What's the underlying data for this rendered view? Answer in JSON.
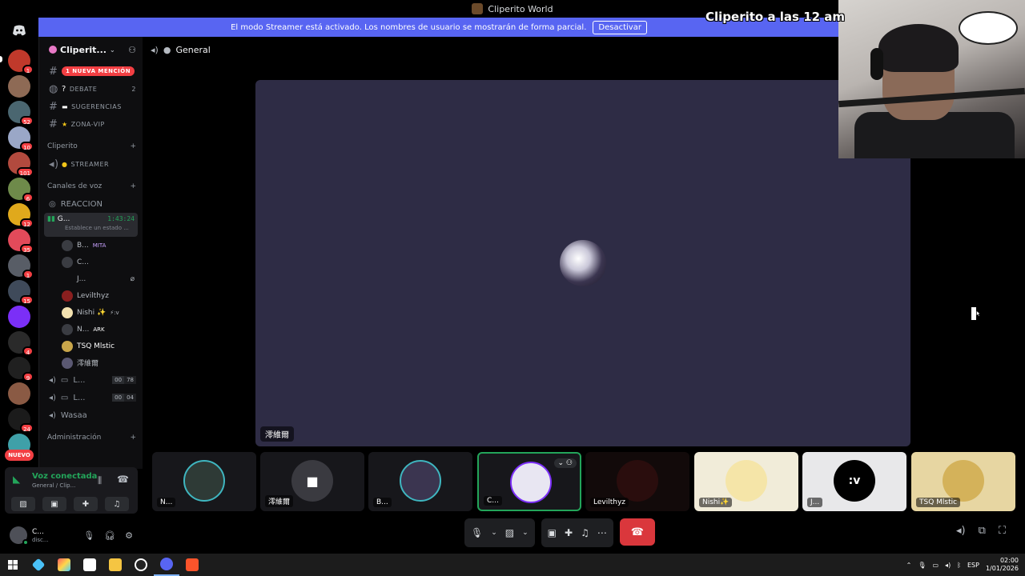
{
  "window": {
    "title": "Cliperito World"
  },
  "banner": {
    "text": "El modo Streamer está activado. Los nombres de usuario se mostrarán de forma parcial.",
    "button": "Desactivar"
  },
  "rail": {
    "badges": [
      "1",
      "52",
      "10",
      "101",
      "6",
      "12",
      "35",
      "1",
      "15",
      "4",
      "9",
      "24"
    ],
    "nuevo": "NUEVO"
  },
  "server": {
    "name": "Cliperit..."
  },
  "channels": {
    "mention_label": "1 NUEVA MENCIÓN",
    "debate": {
      "name": "DEBATE",
      "count": "2"
    },
    "sugerencias": "SUGERENCIAS",
    "zona_vip": "ZONA-VIP",
    "category_cliperito": "Cliperito",
    "streamer": "STREAMER",
    "category_voz": "Canales de voz",
    "reaccion": "REACCION",
    "active_voice": {
      "name": "G...",
      "timer": "1:43:24",
      "status": "Establece un estado ..."
    },
    "voice_users": [
      "B...",
      "MITA",
      "C...",
      "J...",
      "Levilthyz",
      "Nishi ✨",
      "⚡:v",
      "N...",
      "ARK",
      "TSQ Mlstic",
      "澪維爾"
    ],
    "vchannels": [
      {
        "name": "L...",
        "a": "00",
        "b": "78"
      },
      {
        "name": "L...",
        "a": "00",
        "b": "04"
      }
    ],
    "wasaa": "Wasaa",
    "category_admin": "Administración"
  },
  "voice_panel": {
    "status": "Voz conectada",
    "location": "General / Clip..."
  },
  "user": {
    "name": "C...",
    "status": "disc..."
  },
  "topbar": {
    "channel": "General"
  },
  "stage": {
    "label": "澪維爾"
  },
  "tiles": [
    {
      "name": "N..."
    },
    {
      "name": "澪維爾"
    },
    {
      "name": "B..."
    },
    {
      "name": "C..."
    },
    {
      "name": "Levilthyz"
    },
    {
      "name": "Nishi✨"
    },
    {
      "name": "J...",
      "avatar_text": ":v"
    },
    {
      "name": "TSQ Mlstic"
    }
  ],
  "overlay": {
    "text": "Cliperito a las 12 am"
  },
  "taskbar": {
    "lang": "ESP",
    "time": "02:00",
    "date": "1/01/2026"
  },
  "colors": {
    "accent": "#5865f2",
    "green": "#23a55a",
    "red": "#da373c"
  }
}
